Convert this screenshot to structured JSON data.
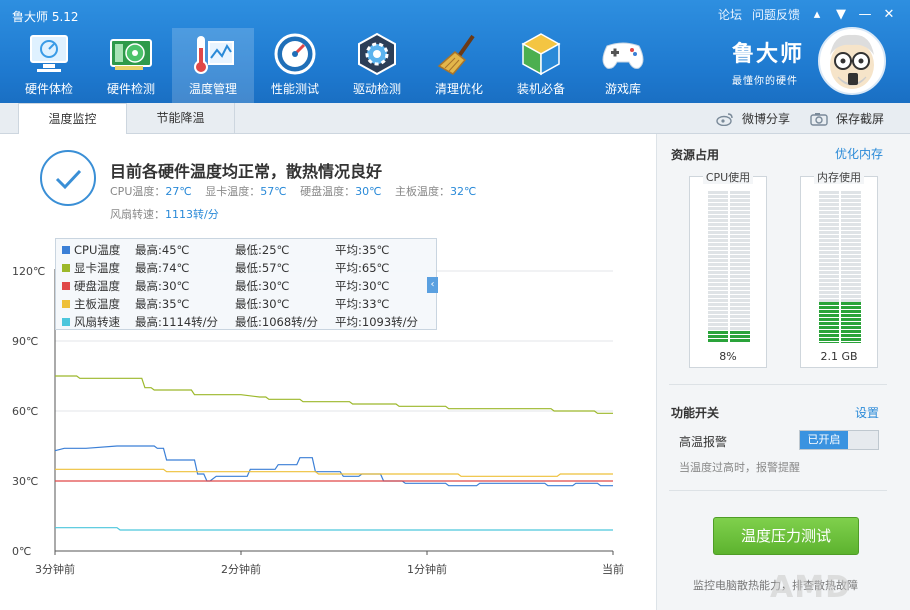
{
  "app": {
    "title": "鲁大师 5.12",
    "top_links": [
      "论坛",
      "问题反馈"
    ],
    "brand_name": "鲁大师",
    "brand_slogan": "最懂你的硬件"
  },
  "nav": [
    {
      "label": "硬件体检",
      "icon": "monitor-icon"
    },
    {
      "label": "硬件检测",
      "icon": "graphics-card-icon"
    },
    {
      "label": "温度管理",
      "icon": "thermometer-icon",
      "active": true
    },
    {
      "label": "性能测试",
      "icon": "speedometer-icon"
    },
    {
      "label": "驱动检测",
      "icon": "gear-icon"
    },
    {
      "label": "清理优化",
      "icon": "broom-icon"
    },
    {
      "label": "装机必备",
      "icon": "cube-icon"
    },
    {
      "label": "游戏库",
      "icon": "gamepad-icon"
    }
  ],
  "subtabs": {
    "temp_monitor": "温度监控",
    "power_saving": "节能降温",
    "weibo_share": "微博分享",
    "save_screenshot": "保存截屏"
  },
  "status": {
    "title": "目前各硬件温度均正常，散热情况良好",
    "cpu_label": "CPU温度：",
    "cpu_value": "27℃",
    "gpu_label": "显卡温度：",
    "gpu_value": "57℃",
    "disk_label": "硬盘温度：",
    "disk_value": "30℃",
    "board_label": "主板温度：",
    "board_value": "32℃",
    "fan_label": "风扇转速：",
    "fan_value": "1113转/分"
  },
  "legend": [
    {
      "name": "CPU温度",
      "max": "最高:45℃",
      "min": "最低:25℃",
      "avg": "平均:35℃",
      "color": "#3b7fd6"
    },
    {
      "name": "显卡温度",
      "max": "最高:74℃",
      "min": "最低:57℃",
      "avg": "平均:65℃",
      "color": "#9cb82a"
    },
    {
      "name": "硬盘温度",
      "max": "最高:30℃",
      "min": "最低:30℃",
      "avg": "平均:30℃",
      "color": "#e04848"
    },
    {
      "name": "主板温度",
      "max": "最高:35℃",
      "min": "最低:30℃",
      "avg": "平均:33℃",
      "color": "#eec03a"
    },
    {
      "name": "风扇转速",
      "max": "最高:1114转/分",
      "min": "最低:1068转/分",
      "avg": "平均:1093转/分",
      "color": "#4cc6dc"
    }
  ],
  "chart_data": {
    "type": "line",
    "y_ticks": [
      "120℃",
      "90℃",
      "60℃",
      "30℃",
      "0℃"
    ],
    "x_ticks": [
      "3分钟前",
      "2分钟前",
      "1分钟前",
      "当前"
    ],
    "ylim": [
      0,
      120
    ],
    "x_range": [
      0,
      180
    ],
    "x_unit": "seconds elapsed",
    "series": [
      {
        "name": "CPU温度",
        "color": "#3b7fd6",
        "values": [
          [
            0,
            43
          ],
          [
            3,
            44
          ],
          [
            10,
            44
          ],
          [
            20,
            45
          ],
          [
            32,
            45
          ],
          [
            33,
            44
          ],
          [
            35,
            44
          ],
          [
            36,
            39
          ],
          [
            45,
            39
          ],
          [
            46,
            33
          ],
          [
            48,
            33
          ],
          [
            49,
            30
          ],
          [
            50,
            30
          ],
          [
            52,
            32
          ],
          [
            62,
            32
          ],
          [
            63,
            35
          ],
          [
            71,
            35
          ],
          [
            72,
            37
          ],
          [
            78,
            37
          ],
          [
            79,
            40
          ],
          [
            83,
            40
          ],
          [
            84,
            34
          ],
          [
            92,
            34
          ],
          [
            93,
            32
          ],
          [
            98,
            32
          ],
          [
            99,
            33
          ],
          [
            105,
            33
          ],
          [
            106,
            30
          ],
          [
            112,
            30
          ],
          [
            113,
            29
          ],
          [
            126,
            29
          ],
          [
            127,
            28
          ],
          [
            136,
            28
          ],
          [
            137,
            29
          ],
          [
            145,
            29
          ],
          [
            146,
            29
          ],
          [
            158,
            29
          ],
          [
            159,
            28
          ],
          [
            167,
            28
          ],
          [
            168,
            29
          ],
          [
            175,
            29
          ],
          [
            176,
            28
          ],
          [
            180,
            28
          ]
        ]
      },
      {
        "name": "显卡温度",
        "color": "#9cb82a",
        "values": [
          [
            0,
            75
          ],
          [
            7,
            75
          ],
          [
            8,
            74
          ],
          [
            20,
            74
          ],
          [
            28,
            74
          ],
          [
            29,
            70
          ],
          [
            31,
            70
          ],
          [
            32,
            69
          ],
          [
            44,
            69
          ],
          [
            45,
            67
          ],
          [
            60,
            67
          ],
          [
            66,
            66
          ],
          [
            68,
            66
          ],
          [
            69,
            65
          ],
          [
            79,
            65
          ],
          [
            80,
            64
          ],
          [
            95,
            64
          ],
          [
            96,
            63
          ],
          [
            110,
            63
          ],
          [
            111,
            62
          ],
          [
            126,
            62
          ],
          [
            127,
            61
          ],
          [
            160,
            61
          ],
          [
            161,
            60
          ],
          [
            174,
            60
          ],
          [
            175,
            59
          ],
          [
            180,
            59
          ]
        ]
      },
      {
        "name": "硬盘温度",
        "color": "#e04848",
        "values": [
          [
            0,
            30
          ],
          [
            180,
            30
          ]
        ]
      },
      {
        "name": "主板温度",
        "color": "#eec03a",
        "values": [
          [
            0,
            35
          ],
          [
            35,
            35
          ],
          [
            36,
            34
          ],
          [
            84,
            34
          ],
          [
            85,
            33
          ],
          [
            130,
            33
          ],
          [
            131,
            32
          ],
          [
            162,
            32
          ],
          [
            163,
            33
          ],
          [
            180,
            33
          ]
        ]
      },
      {
        "name": "风扇转速",
        "color": "#4cc6dc",
        "scale_note": "plotted on same area",
        "values": [
          [
            0,
            10
          ],
          [
            20,
            10
          ],
          [
            21,
            9
          ],
          [
            180,
            9
          ]
        ]
      }
    ]
  },
  "side": {
    "resource_title": "资源占用",
    "optimize_link": "优化内存",
    "cpu_caption": "CPU使用",
    "cpu_value": "8%",
    "cpu_level": 0.08,
    "mem_caption": "内存使用",
    "mem_value": "2.1 GB",
    "mem_level": 0.27,
    "func_title": "功能开关",
    "settings_link": "设置",
    "alarm_label": "高温报警",
    "alarm_state": "已开启",
    "alarm_desc": "当温度过高时，报警提醒",
    "stress_button": "温度压力测试",
    "stress_note": "监控电脑散热能力，排查散热故障"
  },
  "watermark": "AMD"
}
